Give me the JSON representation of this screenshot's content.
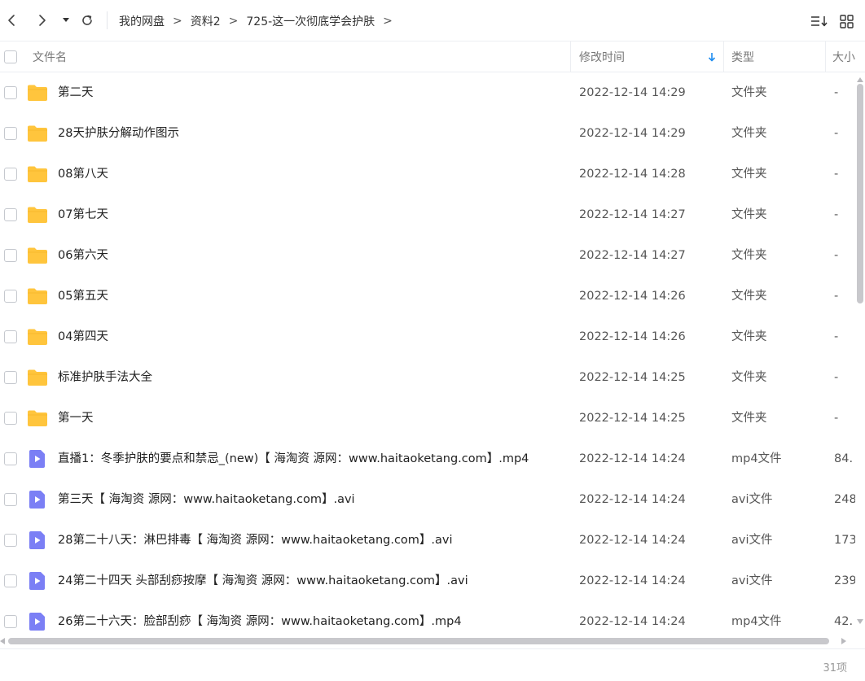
{
  "toolbar": {
    "breadcrumbs": [
      "我的网盘",
      "资料2",
      "725-这一次彻底学会护肤"
    ],
    "crumb_separator": ">"
  },
  "columns": {
    "name": "文件名",
    "modified": "修改时间",
    "type": "类型",
    "size": "大小"
  },
  "colors": {
    "folder": "#FFC53D",
    "video": "#7B7FF5",
    "sort_arrow": "#1E8CF0"
  },
  "files": [
    {
      "name": "第二天",
      "modified": "2022-12-14 14:29",
      "type": "文件夹",
      "size": "-",
      "icon": "folder-icon"
    },
    {
      "name": "28天护肤分解动作图示",
      "modified": "2022-12-14 14:29",
      "type": "文件夹",
      "size": "-",
      "icon": "folder-icon"
    },
    {
      "name": "08第八天",
      "modified": "2022-12-14 14:28",
      "type": "文件夹",
      "size": "-",
      "icon": "folder-icon"
    },
    {
      "name": "07第七天",
      "modified": "2022-12-14 14:27",
      "type": "文件夹",
      "size": "-",
      "icon": "folder-icon"
    },
    {
      "name": "06第六天",
      "modified": "2022-12-14 14:27",
      "type": "文件夹",
      "size": "-",
      "icon": "folder-icon"
    },
    {
      "name": "05第五天",
      "modified": "2022-12-14 14:26",
      "type": "文件夹",
      "size": "-",
      "icon": "folder-icon"
    },
    {
      "name": "04第四天",
      "modified": "2022-12-14 14:26",
      "type": "文件夹",
      "size": "-",
      "icon": "folder-icon"
    },
    {
      "name": "标准护肤手法大全",
      "modified": "2022-12-14 14:25",
      "type": "文件夹",
      "size": "-",
      "icon": "folder-icon"
    },
    {
      "name": "第一天",
      "modified": "2022-12-14 14:25",
      "type": "文件夹",
      "size": "-",
      "icon": "folder-icon"
    },
    {
      "name": "直播1：冬季护肤的要点和禁忌_(new)【 海淘资 源网：www.haitaoketang.com】.mp4",
      "modified": "2022-12-14 14:24",
      "type": "mp4文件",
      "size": "84.",
      "icon": "video-file-icon"
    },
    {
      "name": "第三天【 海淘资 源网：www.haitaoketang.com】.avi",
      "modified": "2022-12-14 14:24",
      "type": "avi文件",
      "size": "248",
      "icon": "video-file-icon"
    },
    {
      "name": "28第二十八天：淋巴排毒【 海淘资 源网：www.haitaoketang.com】.avi",
      "modified": "2022-12-14 14:24",
      "type": "avi文件",
      "size": "173",
      "icon": "video-file-icon"
    },
    {
      "name": "24第二十四天 头部刮痧按摩【 海淘资 源网：www.haitaoketang.com】.avi",
      "modified": "2022-12-14 14:24",
      "type": "avi文件",
      "size": "239",
      "icon": "video-file-icon"
    },
    {
      "name": "26第二十六天：脸部刮痧【 海淘资 源网：www.haitaoketang.com】.mp4",
      "modified": "2022-12-14 14:24",
      "type": "mp4文件",
      "size": "42.",
      "icon": "video-file-icon"
    }
  ],
  "footer": {
    "item_count": "31项"
  }
}
